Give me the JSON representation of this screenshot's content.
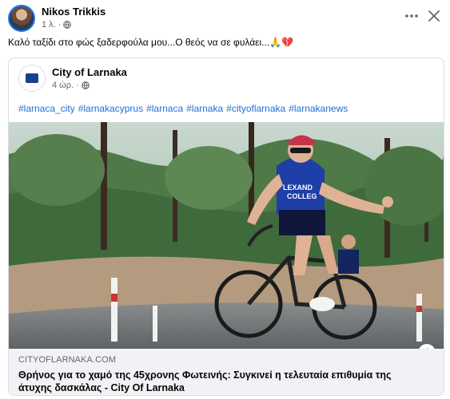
{
  "post": {
    "author": "Nikos Trikkis",
    "time": "1 λ.",
    "separator": "·",
    "caption": "Καλό ταξίδι στο φώς ξαδερφούλα μου...Ο θεός να σε φυλάει...🙏💔"
  },
  "shared": {
    "page_name": "City of Larnaka",
    "time": "4 ώρ.",
    "separator": "·",
    "hashtags": [
      "#larnaca_city",
      "#larnakacyprus",
      "#larnaca",
      "#larnaka",
      "#cityoflarnaka",
      "#larnakanews"
    ],
    "domain": "CITYOFLARNAKA.COM",
    "link_title": "Θρήνος για το χαμό της 45χρονης Φωτεινής: Συγκινεί η τελευταία επιθυμία της άτυχης δασκάλας - City Of Larnaka",
    "info_glyph": "i"
  },
  "icons": [
    "globe-icon",
    "more-icon",
    "close-icon",
    "info-icon"
  ],
  "colors": {
    "link": "#216fdb",
    "secondary_text": "#65676b",
    "link_box_bg": "#f0f2f5",
    "avatar_ring": "#1877f2"
  }
}
